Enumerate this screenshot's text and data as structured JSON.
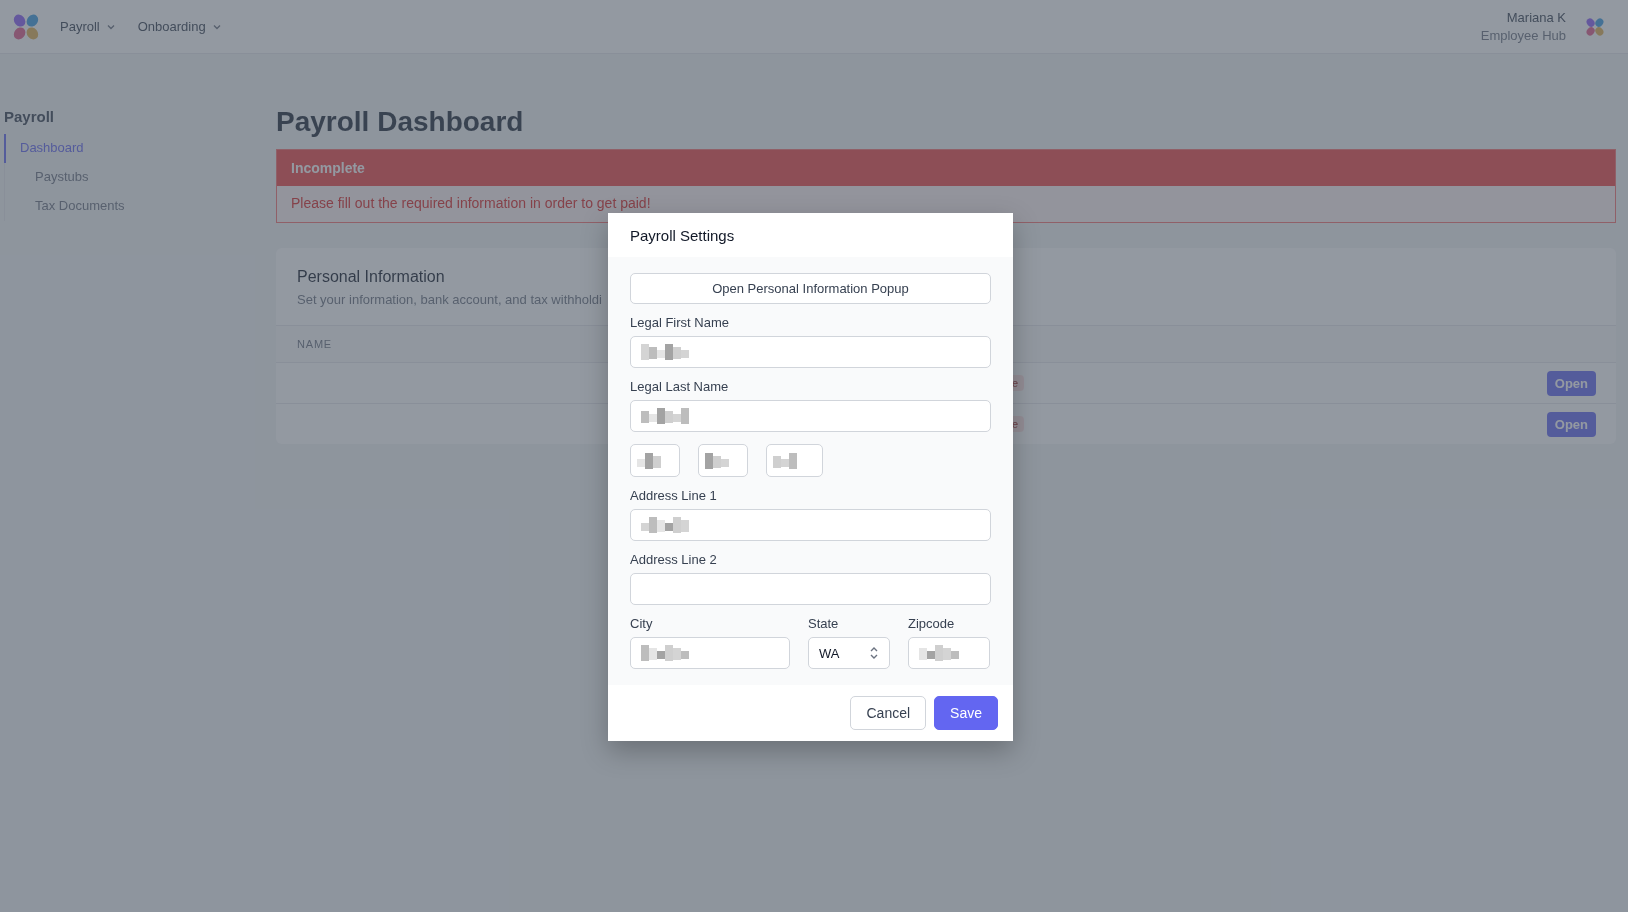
{
  "top_nav": {
    "menus": [
      {
        "label": "Payroll"
      },
      {
        "label": "Onboarding"
      }
    ],
    "user": {
      "name": "Mariana K",
      "role": "Employee Hub"
    }
  },
  "sidebar": {
    "heading": "Payroll",
    "items": [
      {
        "label": "Dashboard",
        "selected": true
      },
      {
        "label": "Paystubs",
        "selected": false
      },
      {
        "label": "Tax Documents",
        "selected": false
      }
    ]
  },
  "page": {
    "title": "Payroll Dashboard",
    "alert": {
      "title": "Incomplete",
      "message": "Please fill out the required information in order to get paid!"
    },
    "card": {
      "title": "Personal Information",
      "subtitle": "Set your information, bank account, and tax withholdi",
      "columns": [
        "NAME"
      ],
      "rows": [
        {
          "badge": "e",
          "action": "Open"
        },
        {
          "badge": "e",
          "action": "Open"
        }
      ]
    }
  },
  "modal": {
    "title": "Payroll Settings",
    "popup_button": "Open Personal Information Popup",
    "fields": [
      {
        "label": "Legal First Name",
        "redacted": true
      },
      {
        "label": "Legal Last Name",
        "redacted": true
      }
    ],
    "small_fields": [
      {
        "redacted": true
      },
      {
        "redacted": true
      },
      {
        "redacted": true
      }
    ],
    "address_fields": [
      {
        "label": "Address Line 1",
        "redacted": true
      },
      {
        "label": "Address Line 2",
        "redacted": false
      }
    ],
    "city": {
      "label": "City",
      "redacted": true
    },
    "state": {
      "label": "State",
      "value": "WA"
    },
    "zipcode": {
      "label": "Zipcode",
      "redacted": true
    },
    "buttons": [
      {
        "label": "Cancel",
        "kind": "secondary"
      },
      {
        "label": "Save",
        "kind": "primary"
      }
    ]
  }
}
